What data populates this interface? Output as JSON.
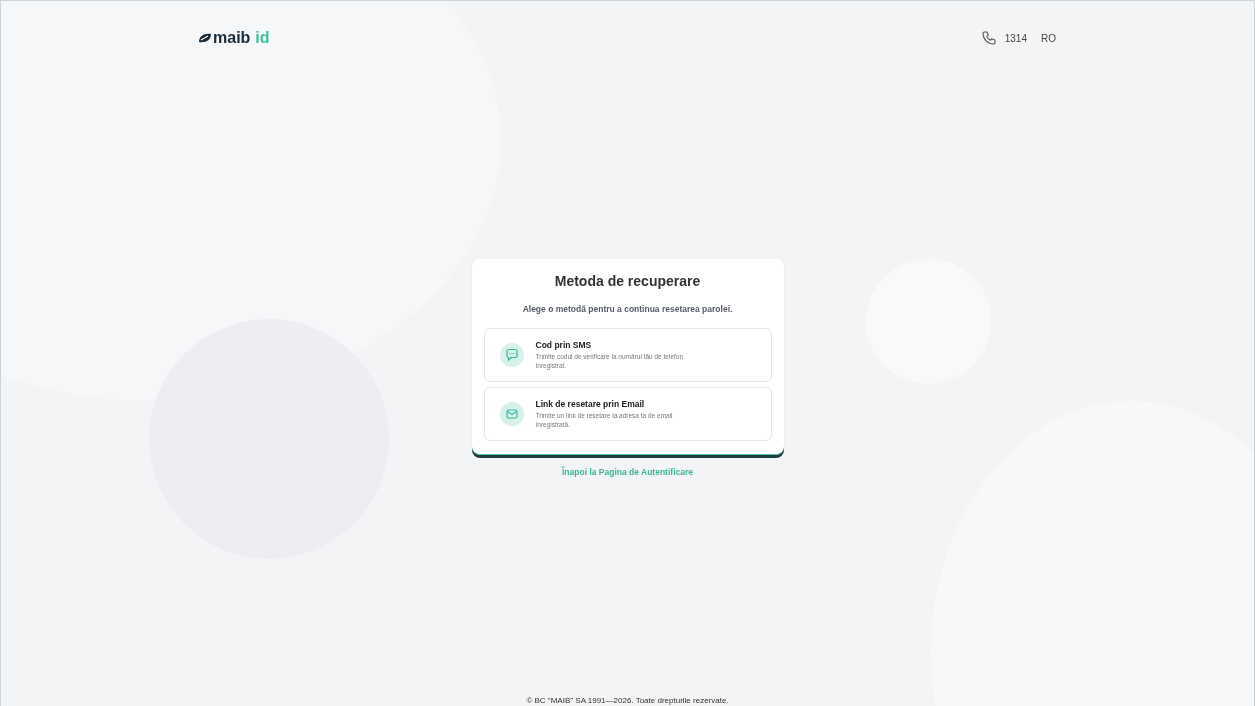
{
  "header": {
    "logo": {
      "brand": "maib",
      "suffix": "id"
    },
    "phone": "1314",
    "language": "RO"
  },
  "card": {
    "title": "Metoda de recuperare",
    "subtitle": "Alege o metodă pentru a continua resetarea parolei.",
    "methods": [
      {
        "kind": "sms",
        "title": "Cod prin SMS",
        "description": "Trimite codul de verificare la numărul tău de telefon înregistrat."
      },
      {
        "kind": "email",
        "title": "Link de resetare prin Email",
        "description": "Trimite un link de resetare la adresa ta de email înregistrată."
      }
    ]
  },
  "back_link": "Înapoi la Pagina de Autentificare",
  "footer": "© BC \"MAIB\" SA 1991—2026. Toate drepturile rezervate."
}
